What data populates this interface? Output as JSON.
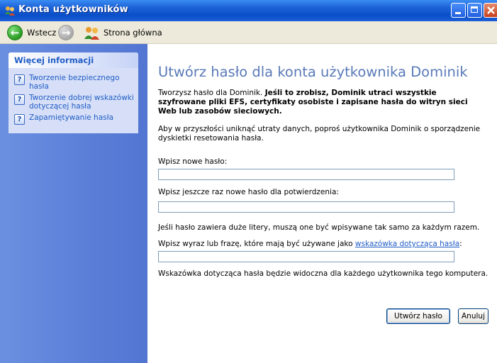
{
  "window": {
    "title": "Konta użytkowników",
    "controls": [
      "minimize",
      "maximize",
      "close"
    ],
    "title_bar_color": "#0a4fc8"
  },
  "toolbar": {
    "back_label": "Wstecz",
    "back_icon": "back-arrow-icon",
    "forward_icon": "forward-arrow-icon",
    "home_label": "Strona główna",
    "home_icon": "users-icon"
  },
  "sidebar": {
    "header": "Więcej informacji",
    "items": [
      {
        "line1": "Tworzenie bezpiecznego",
        "line2": "hasła",
        "icon": "help-icon"
      },
      {
        "line1": "Tworzenie dobrej wskazówki",
        "line2": "dotyczącej hasła",
        "icon": "help-icon"
      },
      {
        "line1": "Zapamiętywanie hasła",
        "line2": "",
        "icon": "help-icon"
      }
    ]
  },
  "main": {
    "heading": "Utwórz hasło dla konta użytkownika Dominik",
    "warning": {
      "line1_normal": "Tworzysz hasło dla Dominik. ",
      "line1_bold": "Jeśli to zrobisz, Dominik utraci wszystkie",
      "line2": "szyfrowane pliki EFS, certyfikaty osobiste i zapisane hasła do witryn sieci",
      "line3": "Web lub zasobów sieciowych."
    },
    "info_line1": "Aby w przyszłości uniknąć utraty danych, poproś użytkownika Dominik o sporządzenie",
    "info_line2": "dyskietki resetowania hasła.",
    "new_password_label": "Wpisz nowe hasło:",
    "new_password_value": "",
    "confirm_password_label": "Wpisz jeszcze raz nowe hasło dla potwierdzenia:",
    "confirm_password_value": "",
    "caps_note": "Jeśli hasło zawiera duże litery, muszą one być wpisywane tak samo za każdym razem.",
    "hint_label_prefix": "Wpisz wyraz lub frazę, które mają być używane jako ",
    "hint_label_link": "wskazówka dotycząca hasła",
    "hint_label_suffix": ":",
    "hint_value": "",
    "hint_note": "Wskazówka dotycząca hasła będzie widoczna dla każdego użytkownika tego komputera.",
    "create_button": "Utwórz hasło",
    "cancel_button": "Anuluj"
  }
}
